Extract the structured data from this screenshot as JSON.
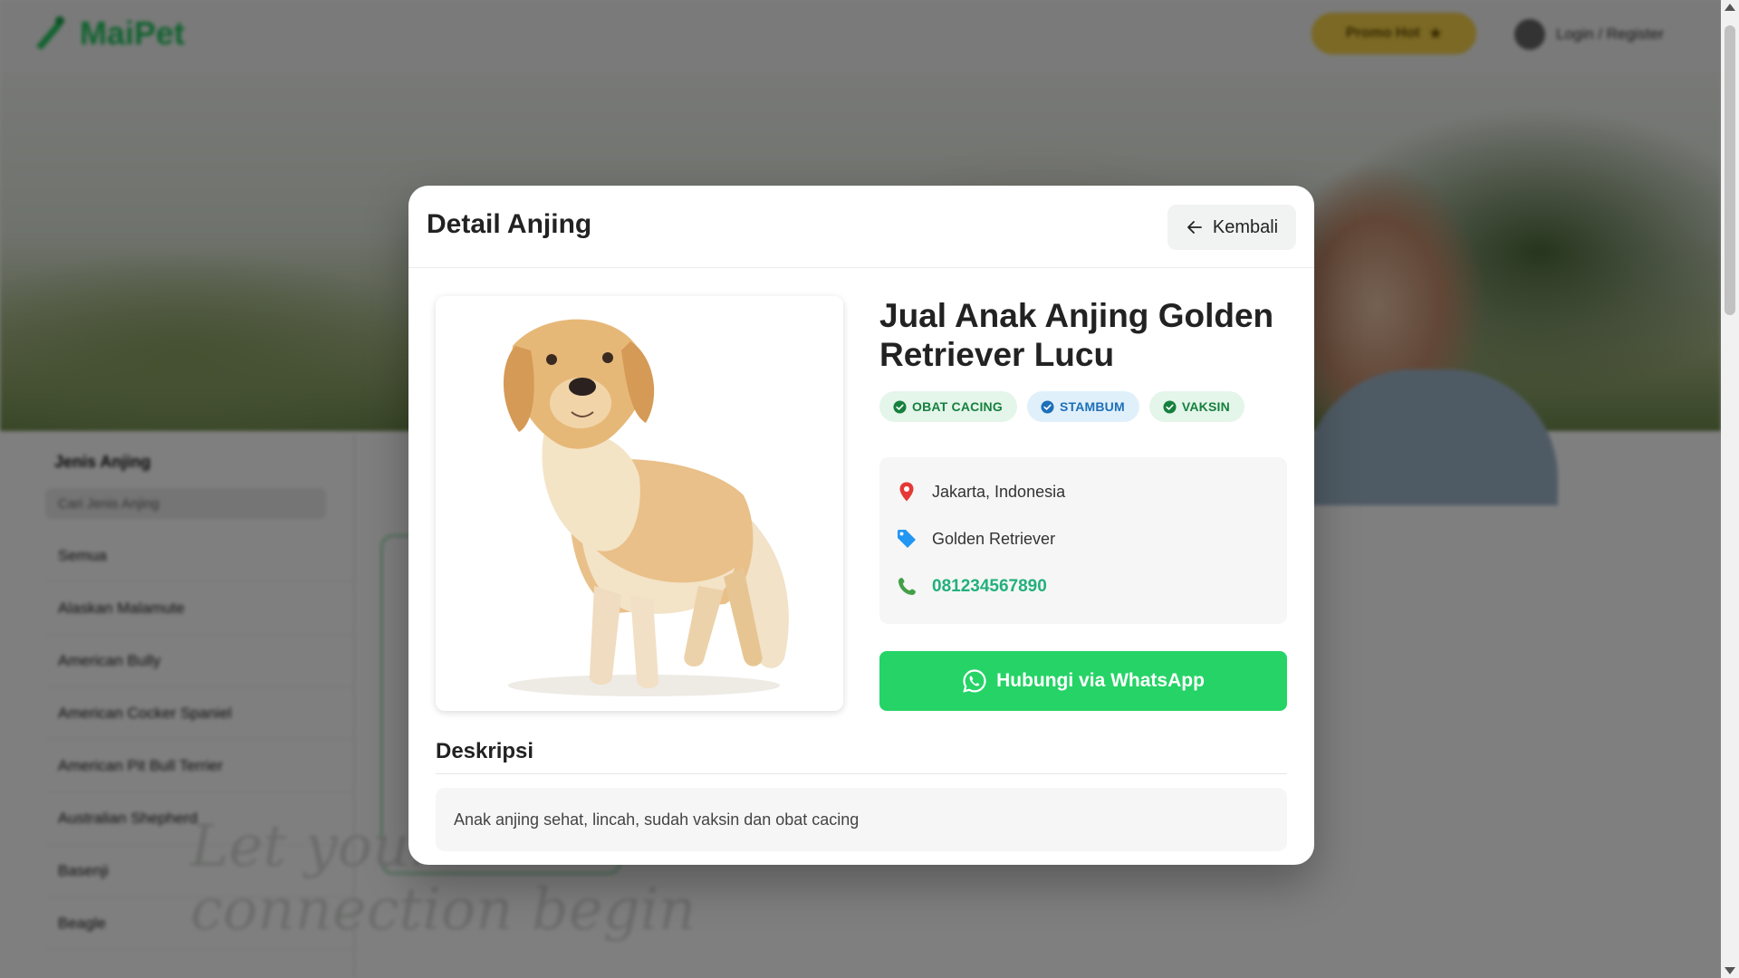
{
  "app": {
    "logo_text": "MaiPet"
  },
  "header": {
    "promo_label": "Promo Hot",
    "login_label": "Login / Register"
  },
  "sidebar": {
    "title": "Jenis Anjing",
    "search_placeholder": "Cari Jenis Anjing",
    "items": [
      {
        "label": "Semua"
      },
      {
        "label": "Alaskan Malamute"
      },
      {
        "label": "American Bully"
      },
      {
        "label": "American Cocker Spaniel"
      },
      {
        "label": "American Pit Bull Terrier"
      },
      {
        "label": "Australian Shepherd"
      },
      {
        "label": "Basenji"
      },
      {
        "label": "Beagle"
      }
    ]
  },
  "background_overlay_text": {
    "line1": "Let your",
    "line2": "connection begin"
  },
  "modal": {
    "title": "Detail Anjing",
    "back_label": "Kembali",
    "listing_title": "Jual Anak Anjing Golden Retriever Lucu",
    "badges": [
      {
        "label": "OBAT CACING",
        "color": "#15803d",
        "bg": "#e4f5ea"
      },
      {
        "label": "STAMBUM",
        "color": "#1d6fb8",
        "bg": "#e0f0fb"
      },
      {
        "label": "VAKSIN",
        "color": "#15803d",
        "bg": "#e4f5ea"
      }
    ],
    "location": "Jakarta, Indonesia",
    "breed": "Golden Retriever",
    "phone": "081234567890",
    "whatsapp_label": "Hubungi via WhatsApp",
    "description_heading": "Deskripsi",
    "description": "Anak anjing sehat, lincah, sudah vaksin dan obat cacing"
  },
  "colors": {
    "brand": "#22c55e",
    "whatsapp": "#25d366",
    "phone": "#22b07d",
    "location_icon": "#e53935",
    "tag_icon": "#2196f3",
    "phone_icon": "#43a047"
  },
  "icons": {
    "back": "arrow-left-icon",
    "location": "map-pin-icon",
    "breed": "tag-icon",
    "phone": "phone-icon",
    "whatsapp": "whatsapp-icon",
    "badge": "check-circle-icon"
  }
}
